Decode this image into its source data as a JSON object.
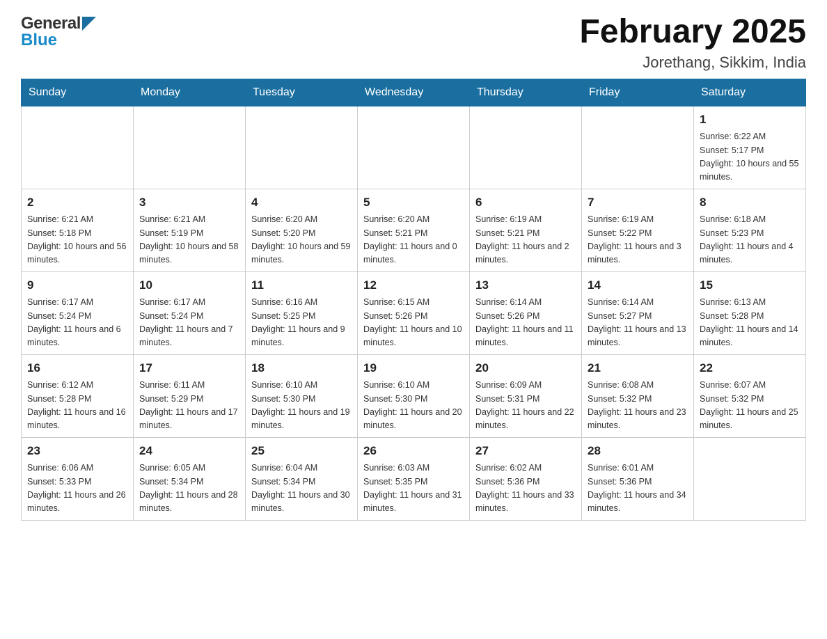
{
  "header": {
    "title": "February 2025",
    "subtitle": "Jorethang, Sikkim, India"
  },
  "logo": {
    "general": "General",
    "blue": "Blue"
  },
  "days": [
    "Sunday",
    "Monday",
    "Tuesday",
    "Wednesday",
    "Thursday",
    "Friday",
    "Saturday"
  ],
  "weeks": [
    [
      {
        "num": "",
        "info": ""
      },
      {
        "num": "",
        "info": ""
      },
      {
        "num": "",
        "info": ""
      },
      {
        "num": "",
        "info": ""
      },
      {
        "num": "",
        "info": ""
      },
      {
        "num": "",
        "info": ""
      },
      {
        "num": "1",
        "info": "Sunrise: 6:22 AM\nSunset: 5:17 PM\nDaylight: 10 hours and 55 minutes."
      }
    ],
    [
      {
        "num": "2",
        "info": "Sunrise: 6:21 AM\nSunset: 5:18 PM\nDaylight: 10 hours and 56 minutes."
      },
      {
        "num": "3",
        "info": "Sunrise: 6:21 AM\nSunset: 5:19 PM\nDaylight: 10 hours and 58 minutes."
      },
      {
        "num": "4",
        "info": "Sunrise: 6:20 AM\nSunset: 5:20 PM\nDaylight: 10 hours and 59 minutes."
      },
      {
        "num": "5",
        "info": "Sunrise: 6:20 AM\nSunset: 5:21 PM\nDaylight: 11 hours and 0 minutes."
      },
      {
        "num": "6",
        "info": "Sunrise: 6:19 AM\nSunset: 5:21 PM\nDaylight: 11 hours and 2 minutes."
      },
      {
        "num": "7",
        "info": "Sunrise: 6:19 AM\nSunset: 5:22 PM\nDaylight: 11 hours and 3 minutes."
      },
      {
        "num": "8",
        "info": "Sunrise: 6:18 AM\nSunset: 5:23 PM\nDaylight: 11 hours and 4 minutes."
      }
    ],
    [
      {
        "num": "9",
        "info": "Sunrise: 6:17 AM\nSunset: 5:24 PM\nDaylight: 11 hours and 6 minutes."
      },
      {
        "num": "10",
        "info": "Sunrise: 6:17 AM\nSunset: 5:24 PM\nDaylight: 11 hours and 7 minutes."
      },
      {
        "num": "11",
        "info": "Sunrise: 6:16 AM\nSunset: 5:25 PM\nDaylight: 11 hours and 9 minutes."
      },
      {
        "num": "12",
        "info": "Sunrise: 6:15 AM\nSunset: 5:26 PM\nDaylight: 11 hours and 10 minutes."
      },
      {
        "num": "13",
        "info": "Sunrise: 6:14 AM\nSunset: 5:26 PM\nDaylight: 11 hours and 11 minutes."
      },
      {
        "num": "14",
        "info": "Sunrise: 6:14 AM\nSunset: 5:27 PM\nDaylight: 11 hours and 13 minutes."
      },
      {
        "num": "15",
        "info": "Sunrise: 6:13 AM\nSunset: 5:28 PM\nDaylight: 11 hours and 14 minutes."
      }
    ],
    [
      {
        "num": "16",
        "info": "Sunrise: 6:12 AM\nSunset: 5:28 PM\nDaylight: 11 hours and 16 minutes."
      },
      {
        "num": "17",
        "info": "Sunrise: 6:11 AM\nSunset: 5:29 PM\nDaylight: 11 hours and 17 minutes."
      },
      {
        "num": "18",
        "info": "Sunrise: 6:10 AM\nSunset: 5:30 PM\nDaylight: 11 hours and 19 minutes."
      },
      {
        "num": "19",
        "info": "Sunrise: 6:10 AM\nSunset: 5:30 PM\nDaylight: 11 hours and 20 minutes."
      },
      {
        "num": "20",
        "info": "Sunrise: 6:09 AM\nSunset: 5:31 PM\nDaylight: 11 hours and 22 minutes."
      },
      {
        "num": "21",
        "info": "Sunrise: 6:08 AM\nSunset: 5:32 PM\nDaylight: 11 hours and 23 minutes."
      },
      {
        "num": "22",
        "info": "Sunrise: 6:07 AM\nSunset: 5:32 PM\nDaylight: 11 hours and 25 minutes."
      }
    ],
    [
      {
        "num": "23",
        "info": "Sunrise: 6:06 AM\nSunset: 5:33 PM\nDaylight: 11 hours and 26 minutes."
      },
      {
        "num": "24",
        "info": "Sunrise: 6:05 AM\nSunset: 5:34 PM\nDaylight: 11 hours and 28 minutes."
      },
      {
        "num": "25",
        "info": "Sunrise: 6:04 AM\nSunset: 5:34 PM\nDaylight: 11 hours and 30 minutes."
      },
      {
        "num": "26",
        "info": "Sunrise: 6:03 AM\nSunset: 5:35 PM\nDaylight: 11 hours and 31 minutes."
      },
      {
        "num": "27",
        "info": "Sunrise: 6:02 AM\nSunset: 5:36 PM\nDaylight: 11 hours and 33 minutes."
      },
      {
        "num": "28",
        "info": "Sunrise: 6:01 AM\nSunset: 5:36 PM\nDaylight: 11 hours and 34 minutes."
      },
      {
        "num": "",
        "info": ""
      }
    ]
  ]
}
